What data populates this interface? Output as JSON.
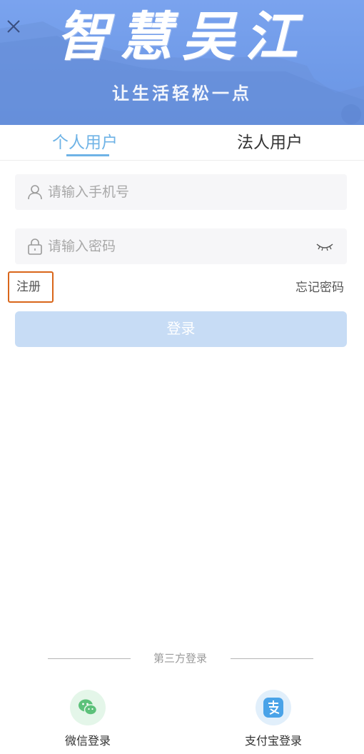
{
  "banner": {
    "title": "智慧吴江",
    "subtitle": "让生活轻松一点",
    "close_icon": "close-icon"
  },
  "tabs": [
    {
      "label": "个人用户",
      "active": true
    },
    {
      "label": "法人用户",
      "active": false
    }
  ],
  "form": {
    "phone": {
      "placeholder": "请输入手机号",
      "value": "",
      "icon": "user-icon"
    },
    "password": {
      "placeholder": "请输入密码",
      "value": "",
      "icon": "lock-icon",
      "toggle_icon": "eye-closed-icon"
    }
  },
  "links": {
    "register": "注册",
    "forgot_password": "忘记密码"
  },
  "login_button": "登录",
  "third_party": {
    "label": "第三方登录",
    "providers": [
      {
        "label": "微信登录",
        "icon": "wechat-icon"
      },
      {
        "label": "支付宝登录",
        "icon": "alipay-icon"
      }
    ]
  },
  "colors": {
    "banner": "#7aa3ee",
    "active_tab": "#6fb3e6",
    "login_button": "#c7dcf5",
    "register_highlight": "#d9661a"
  }
}
